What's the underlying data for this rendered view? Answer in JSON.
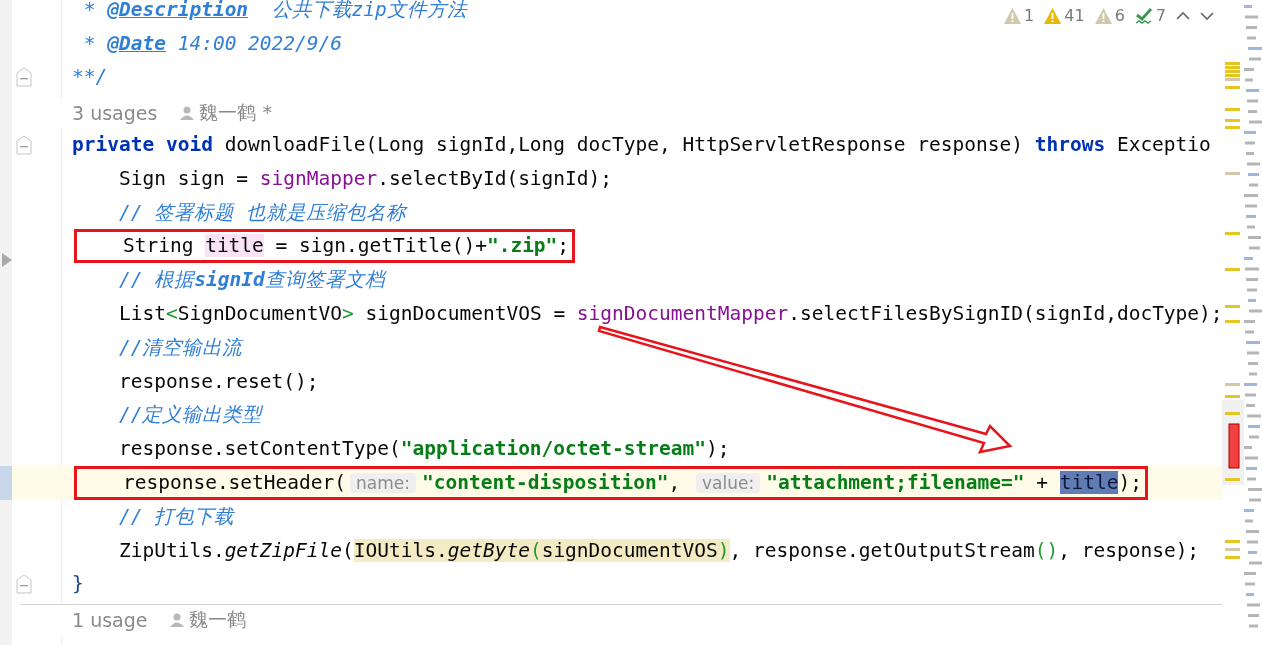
{
  "inspections": [
    {
      "kind": "weak",
      "count": "1"
    },
    {
      "kind": "warning",
      "count": "41"
    },
    {
      "kind": "weak",
      "count": "6"
    },
    {
      "kind": "typo",
      "count": "7"
    }
  ],
  "lines": [
    {
      "kind": "code",
      "fold": false,
      "current": false,
      "boxed": false,
      "tokens": [
        {
          "kind": "comment",
          "text": " * "
        },
        {
          "kind": "doctag",
          "text": "@Description"
        },
        {
          "kind": "comment",
          "text": "  公共下载zip文件方法"
        }
      ]
    },
    {
      "kind": "code",
      "fold": false,
      "current": false,
      "boxed": false,
      "tokens": [
        {
          "kind": "comment",
          "text": " * "
        },
        {
          "kind": "doctag",
          "text": "@Date"
        },
        {
          "kind": "comment",
          "text": " 14:00 2022/9/6"
        }
      ]
    },
    {
      "kind": "code",
      "fold": true,
      "current": false,
      "boxed": false,
      "tokens": [
        {
          "kind": "comment",
          "text": "**/"
        }
      ]
    },
    {
      "kind": "usage",
      "divider": false,
      "usage": "3 usages",
      "author": "魏一鹤 *"
    },
    {
      "kind": "code",
      "fold": true,
      "current": false,
      "boxed": false,
      "tokens": [
        {
          "kind": "keyword",
          "text": "private void"
        },
        {
          "kind": "plain",
          "text": " downloadFile(Long signId,Long docType, HttpServletResponse response) "
        },
        {
          "kind": "keyword",
          "text": "throws"
        },
        {
          "kind": "plain",
          "text": " Exceptio"
        }
      ]
    },
    {
      "kind": "code",
      "fold": false,
      "current": false,
      "boxed": false,
      "tokens": [
        {
          "kind": "plain",
          "text": "    Sign sign = "
        },
        {
          "kind": "field",
          "text": "signMapper"
        },
        {
          "kind": "plain",
          "text": ".selectById(signId);"
        }
      ]
    },
    {
      "kind": "code",
      "fold": false,
      "current": false,
      "boxed": false,
      "tokens": [
        {
          "kind": "comment",
          "text": "    // 签署标题 也就是压缩包名称"
        }
      ]
    },
    {
      "kind": "code",
      "fold": false,
      "current": false,
      "boxed": true,
      "tokens": [
        {
          "kind": "plain",
          "text": "    String "
        },
        {
          "kind": "usage-mark",
          "text": "title"
        },
        {
          "kind": "plain",
          "text": " = sign.getTitle()+"
        },
        {
          "kind": "string",
          "text": "\".zip\""
        },
        {
          "kind": "plain",
          "text": ";"
        }
      ]
    },
    {
      "kind": "code",
      "fold": false,
      "current": false,
      "boxed": false,
      "tokens": [
        {
          "kind": "comment",
          "text": "    // 根据"
        },
        {
          "kind": "comment-bold",
          "text": "signId"
        },
        {
          "kind": "comment",
          "text": "查询签署文档"
        }
      ]
    },
    {
      "kind": "code",
      "fold": false,
      "current": false,
      "boxed": false,
      "tokens": [
        {
          "kind": "plain",
          "text": "    List"
        },
        {
          "kind": "bracket",
          "text": "<"
        },
        {
          "kind": "plain",
          "text": "SignDocumentVO"
        },
        {
          "kind": "bracket",
          "text": ">"
        },
        {
          "kind": "plain",
          "text": " signDocumentVOS = "
        },
        {
          "kind": "field",
          "text": "signDocumentMapper"
        },
        {
          "kind": "plain",
          "text": ".selectFilesBySignID(signId,docType);"
        }
      ]
    },
    {
      "kind": "code",
      "fold": false,
      "current": false,
      "boxed": false,
      "tokens": [
        {
          "kind": "comment",
          "text": "    //清空输出流"
        }
      ]
    },
    {
      "kind": "code",
      "fold": false,
      "current": false,
      "boxed": false,
      "tokens": [
        {
          "kind": "plain",
          "text": "    response.reset();"
        }
      ]
    },
    {
      "kind": "code",
      "fold": false,
      "current": false,
      "boxed": false,
      "tokens": [
        {
          "kind": "comment",
          "text": "    //定义输出类型"
        }
      ]
    },
    {
      "kind": "code",
      "fold": false,
      "current": false,
      "boxed": false,
      "tokens": [
        {
          "kind": "plain",
          "text": "    response.setContentType("
        },
        {
          "kind": "string",
          "text": "\"application/octet-stream\""
        },
        {
          "kind": "plain",
          "text": ");"
        }
      ]
    },
    {
      "kind": "code",
      "fold": false,
      "current": true,
      "boxed": true,
      "tokens": [
        {
          "kind": "plain",
          "text": "    response.setHeader("
        },
        {
          "kind": "hint",
          "text": "name:"
        },
        {
          "kind": "string",
          "text": "\"content-disposition\""
        },
        {
          "kind": "plain",
          "text": ", "
        },
        {
          "kind": "hint",
          "text": "value:"
        },
        {
          "kind": "string",
          "text": "\"attachment;filename=\""
        },
        {
          "kind": "plain",
          "text": " + "
        },
        {
          "kind": "selected",
          "text": "title"
        },
        {
          "kind": "plain",
          "text": ");"
        }
      ]
    },
    {
      "kind": "code",
      "fold": false,
      "current": false,
      "boxed": false,
      "tokens": [
        {
          "kind": "comment",
          "text": "    // 打包下载"
        }
      ]
    },
    {
      "kind": "code",
      "fold": false,
      "current": false,
      "boxed": false,
      "tokens": [
        {
          "kind": "plain",
          "text": "    ZipUtils."
        },
        {
          "kind": "static",
          "text": "getZipFile"
        },
        {
          "kind": "plain",
          "text": "("
        },
        {
          "kind": "match",
          "text": "IOUtils."
        },
        {
          "kind": "match-static",
          "text": "getByte"
        },
        {
          "kind": "match-bracket",
          "text": "("
        },
        {
          "kind": "match",
          "text": "signDocumentVOS"
        },
        {
          "kind": "match-bracket",
          "text": ")"
        },
        {
          "kind": "plain",
          "text": ", response.getOutputStream"
        },
        {
          "kind": "bracket",
          "text": "()"
        },
        {
          "kind": "plain",
          "text": ", response);"
        }
      ]
    },
    {
      "kind": "code",
      "fold": true,
      "current": false,
      "boxed": false,
      "tokens": [
        {
          "kind": "brace",
          "text": "}"
        }
      ]
    },
    {
      "kind": "usage",
      "divider": true,
      "usage": "1 usage",
      "author": "魏一鹤"
    }
  ]
}
